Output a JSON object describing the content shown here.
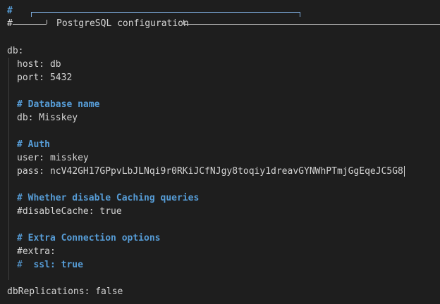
{
  "banner": {
    "line1": "#",
    "line2": "#",
    "title": "PostgreSQL configuration"
  },
  "lines": {
    "db_key": "db:",
    "host": "host: db",
    "port": "port: 5432",
    "c_dbname": "# Database name",
    "db": "db: Misskey",
    "c_auth": "# Auth",
    "user": "user: misskey",
    "pass": "pass: ncV42GH17GPpvLbJLNqi9r0RKiJCfNJgy8toqiy1dreavGYNWhPTmjGgEqeJC5G8",
    "c_cache": "# Whether disable Caching queries",
    "disableCache": "#disableCache: true",
    "c_extra": "# Extra Connection options",
    "extra": "#extra:",
    "ssl_hash": "#",
    "ssl": "ssl: true",
    "dbReplications": "dbReplications: false"
  },
  "colors": {
    "background": "#1e1e1e",
    "text": "#d4d4d4",
    "comment_heading": "#569cd6"
  }
}
